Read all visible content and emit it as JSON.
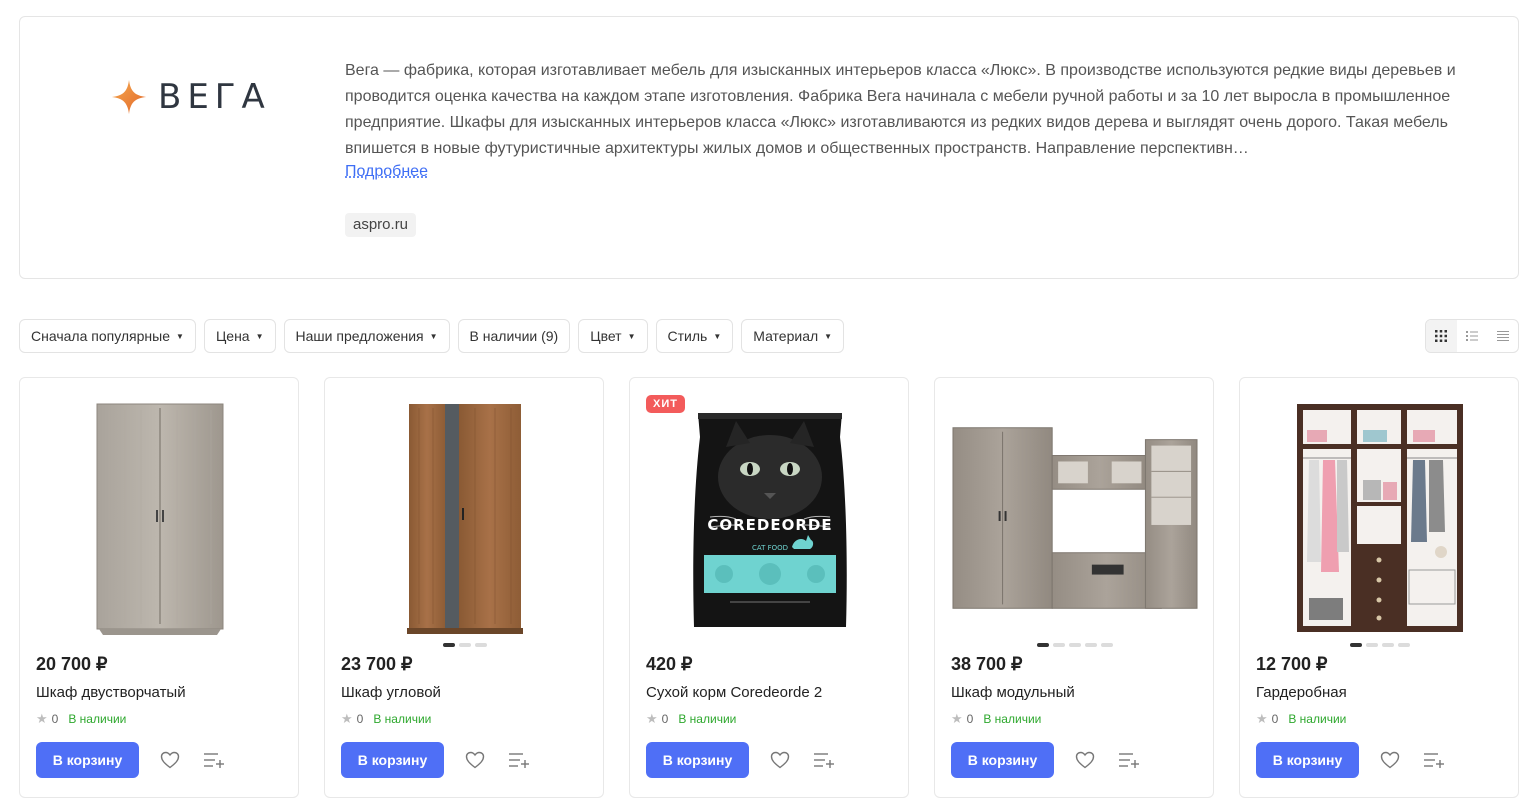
{
  "brand": {
    "logo_text": "ВЕГА",
    "description": "Вега — фабрика, которая изготавливает мебель для изысканных интерьеров класса «Люкс». В производстве используются редкие виды деревьев и проводится оценка качества на каждом этапе изготовления. Фабрика Вега начинала с мебели ручной работы и за 10 лет выросла в промышленное предприятие. Шкафы для изысканных интерьеров класса «Люкс» изготавливаются из редких видов дерева и выглядят очень дорого. Такая мебель впишется в новые футуристичные архитектуры жилых домов и общественных пространств. Направление перспективн…",
    "more_link": "Подробнее",
    "site": "aspro.ru",
    "accent_color": "#f08a3c"
  },
  "filters": [
    {
      "label": "Сначала популярные",
      "caret": true
    },
    {
      "label": "Цена",
      "caret": true
    },
    {
      "label": "Наши предложения",
      "caret": true
    },
    {
      "label": "В наличии (9)",
      "caret": false
    },
    {
      "label": "Цвет",
      "caret": true
    },
    {
      "label": "Стиль",
      "caret": true
    },
    {
      "label": "Материал",
      "caret": true
    }
  ],
  "view_modes": [
    {
      "icon": "grid-icon",
      "active": true
    },
    {
      "icon": "list-icon",
      "active": false
    },
    {
      "icon": "table-icon",
      "active": false
    }
  ],
  "products": [
    {
      "price": "20 700 ₽",
      "name": "Шкаф двустворчатый",
      "rating": "0",
      "stock": "В наличии",
      "cart_label": "В корзину",
      "image": "wardrobe-2-door",
      "badge": null,
      "dots": 0
    },
    {
      "price": "23 700 ₽",
      "name": "Шкаф угловой",
      "rating": "0",
      "stock": "В наличии",
      "cart_label": "В корзину",
      "image": "corner-wardrobe",
      "badge": null,
      "dots": 3
    },
    {
      "price": "420 ₽",
      "name": "Сухой корм Coredeorde 2",
      "rating": "0",
      "stock": "В наличии",
      "cart_label": "В корзину",
      "image": "cat-food-bag",
      "badge": "ХИТ",
      "dots": 0,
      "image_text": {
        "brand": "COREDEORDE",
        "sub": "CAT FOOD"
      }
    },
    {
      "price": "38 700 ₽",
      "name": "Шкаф модульный",
      "rating": "0",
      "stock": "В наличии",
      "cart_label": "В корзину",
      "image": "modular-wall",
      "badge": null,
      "dots": 5
    },
    {
      "price": "12 700 ₽",
      "name": "Гардеробная",
      "rating": "0",
      "stock": "В наличии",
      "cart_label": "В корзину",
      "image": "walk-in-closet",
      "badge": null,
      "dots": 4
    }
  ],
  "colors": {
    "primary_button": "#4f6ff6",
    "in_stock": "#2ea82e",
    "badge_hit": "#f35b5b",
    "link": "#3e6ef5"
  }
}
